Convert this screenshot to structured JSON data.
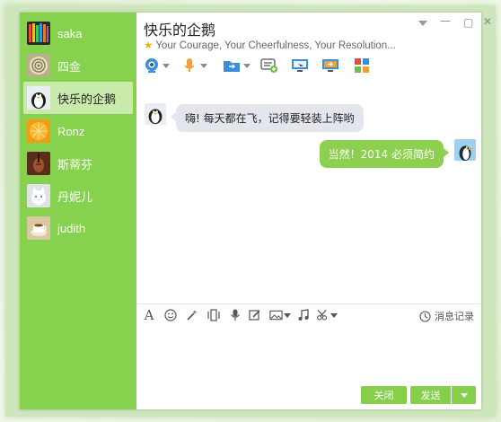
{
  "window": {
    "title": "快乐的企鹅",
    "signature": "Your Courage, Your Cheerfulness, Your Resolution..."
  },
  "contacts": [
    {
      "name": "saka",
      "avatar": "pencils-avatar"
    },
    {
      "name": "四金",
      "avatar": "shell-avatar"
    },
    {
      "name": "快乐的企鹅",
      "avatar": "penguin-avatar",
      "active": true
    },
    {
      "name": "Ronz",
      "avatar": "fruit-avatar"
    },
    {
      "name": "斯蒂芬",
      "avatar": "violin-avatar"
    },
    {
      "name": "丹妮儿",
      "avatar": "cat-avatar"
    },
    {
      "name": "judith",
      "avatar": "coffee-avatar"
    }
  ],
  "messages": [
    {
      "from": "them",
      "text": "嗨! 每天都在飞，记得要轻装上阵哟"
    },
    {
      "from": "me",
      "text": "当然！2014 必须简约"
    }
  ],
  "input_toolbar": {
    "history_label": "消息记录"
  },
  "buttons": {
    "close": "关闭",
    "send": "发送"
  },
  "colors": {
    "accent": "#86d14e",
    "bubble_me": "#8dd04f",
    "bubble_them": "#e3e6ec"
  }
}
